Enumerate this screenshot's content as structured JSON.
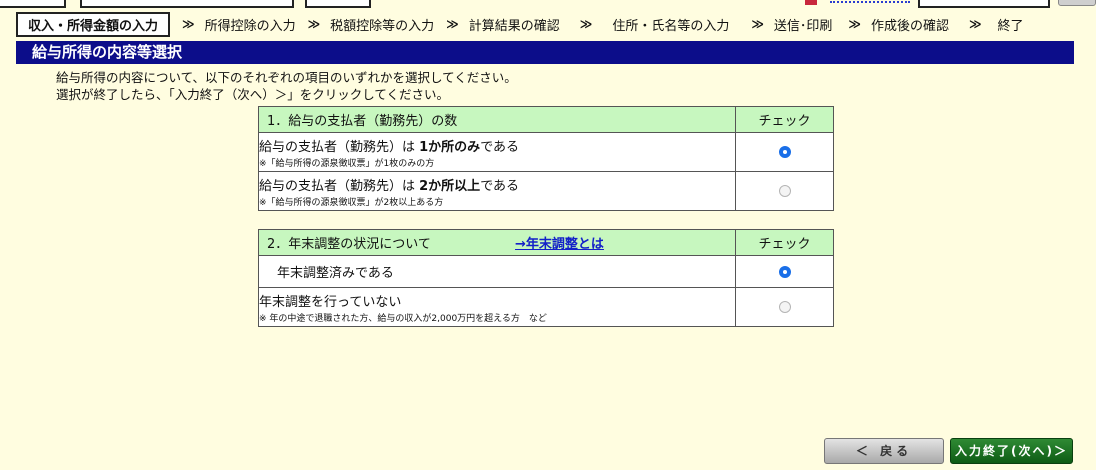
{
  "steps": [
    {
      "label": "収入・所得金額の入力",
      "active": true
    },
    {
      "label": "所得控除の入力"
    },
    {
      "label": "税額控除等の入力"
    },
    {
      "label": "計算結果の確認"
    },
    {
      "label": "住所・氏名等の入力"
    },
    {
      "label": "送信･印刷"
    },
    {
      "label": "作成後の確認"
    },
    {
      "label": "終了"
    }
  ],
  "step_separator": "≫",
  "page_title": "給与所得の内容等選択",
  "intro": {
    "line1": "給与所得の内容について、以下のそれぞれの項目のいずれかを選択してください。",
    "line2": "選択が終了したら、「入力終了（次へ）＞」をクリックしてください。"
  },
  "section1": {
    "header": "1．給与の支払者（勤務先）の数",
    "check_header": "チェック",
    "options": [
      {
        "pre": "給与の支払者（勤務先）は ",
        "bold": "1か所のみ",
        "post": "である",
        "note": "※「給与所得の源泉徴収票」が1枚のみの方",
        "selected": true
      },
      {
        "pre": "給与の支払者（勤務先）は ",
        "bold": "2か所以上",
        "post": "である",
        "note": "※「給与所得の源泉徴収票」が2枚以上ある方",
        "selected": false
      }
    ]
  },
  "section2": {
    "header": "2．年末調整の状況について",
    "link": "→年末調整とは",
    "check_header": "チェック",
    "options": [
      {
        "label": "年末調整済みである",
        "selected": true
      },
      {
        "label": "年末調整を行っていない",
        "note": "※ 年の中途で退職された方、給与の収入が2,000万円を超える方　など",
        "selected": false
      }
    ]
  },
  "buttons": {
    "back": "＜ 戻る",
    "next": "入力終了(次へ)＞"
  },
  "colors": {
    "background": "#fffde0",
    "title_bar": "#0c0d8a",
    "table_header": "#c7f7bf",
    "next_button": "#1a6b20",
    "link": "#1320c8"
  }
}
